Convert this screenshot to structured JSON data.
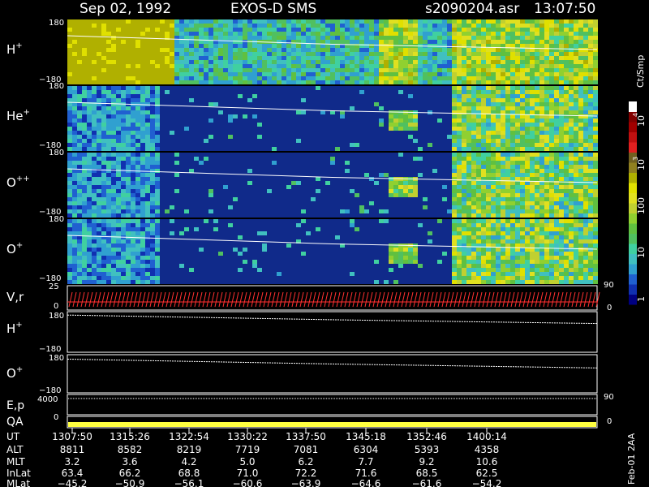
{
  "header": {
    "date": "Sep 02, 1992",
    "instrument": "EXOS-D SMS",
    "file": "s2090204.asr",
    "time": "13:07:50"
  },
  "colorbar": {
    "unit": "Ct/Smp",
    "tick_labels": [
      "1",
      "10",
      "100",
      "10",
      "3",
      "10",
      "4"
    ],
    "colors": [
      "#000080",
      "#1030b0",
      "#2060d0",
      "#30a0d0",
      "#40c0c0",
      "#40d0a0",
      "#50c060",
      "#60c040",
      "#90d030",
      "#c0d030",
      "#e0e020",
      "#e0e000",
      "#b0b000",
      "#908020",
      "#706020",
      "#e02020",
      "#c01010",
      "#a00000",
      "#800000",
      "#ffffff"
    ]
  },
  "panels": [
    {
      "label": "H",
      "sup": "+",
      "ytop": "180",
      "ybot": "−180"
    },
    {
      "label": "He",
      "sup": "+",
      "ytop": "180",
      "ybot": "−180"
    },
    {
      "label": "O",
      "sup": "++",
      "ytop": "180",
      "ybot": "−180"
    },
    {
      "label": "O",
      "sup": "+",
      "ytop": "180",
      "ybot": "−180"
    }
  ],
  "vr": {
    "label": "V,r",
    "ytop": "25",
    "ybot": "0",
    "rtop": "90",
    "rbot": "0"
  },
  "lines": [
    {
      "label": "H",
      "sup": "+",
      "ytop": "180",
      "ybot": "−180"
    },
    {
      "label": "O",
      "sup": "+",
      "ytop": "180",
      "ybot": "−180"
    }
  ],
  "ep": {
    "label": "E,p",
    "ytop": "4000",
    "ybot": "0",
    "rtop": "90"
  },
  "qa": {
    "label": "QA",
    "ybot": "0",
    "rbot": "0"
  },
  "chart_data": {
    "type": "table",
    "row_labels": [
      "UT",
      "ALT",
      "MLT",
      "InLat",
      "MLat"
    ],
    "columns": [
      {
        "UT": "1307:50",
        "ALT": "8811",
        "MLT": "3.2",
        "InLat": "63.4",
        "MLat": "−45.2"
      },
      {
        "UT": "1315:26",
        "ALT": "8582",
        "MLT": "3.6",
        "InLat": "66.2",
        "MLat": "−50.9"
      },
      {
        "UT": "1322:54",
        "ALT": "8219",
        "MLT": "4.2",
        "InLat": "68.8",
        "MLat": "−56.1"
      },
      {
        "UT": "1330:22",
        "ALT": "7719",
        "MLT": "5.0",
        "InLat": "71.0",
        "MLat": "−60.6"
      },
      {
        "UT": "1337:50",
        "ALT": "7081",
        "MLT": "6.2",
        "InLat": "72.2",
        "MLat": "−63.9"
      },
      {
        "UT": "1345:18",
        "ALT": "6304",
        "MLT": "7.7",
        "InLat": "71.6",
        "MLat": "−64.6"
      },
      {
        "UT": "1352:46",
        "ALT": "5393",
        "MLT": "9.2",
        "InLat": "68.5",
        "MLat": "−61.6"
      },
      {
        "UT": "1400:14",
        "ALT": "4358",
        "MLT": "10.6",
        "InLat": "62.5",
        "MLat": "−54.2"
      }
    ],
    "ylim": [
      -180,
      180
    ]
  },
  "footer_side": "Feb-01 2AA"
}
